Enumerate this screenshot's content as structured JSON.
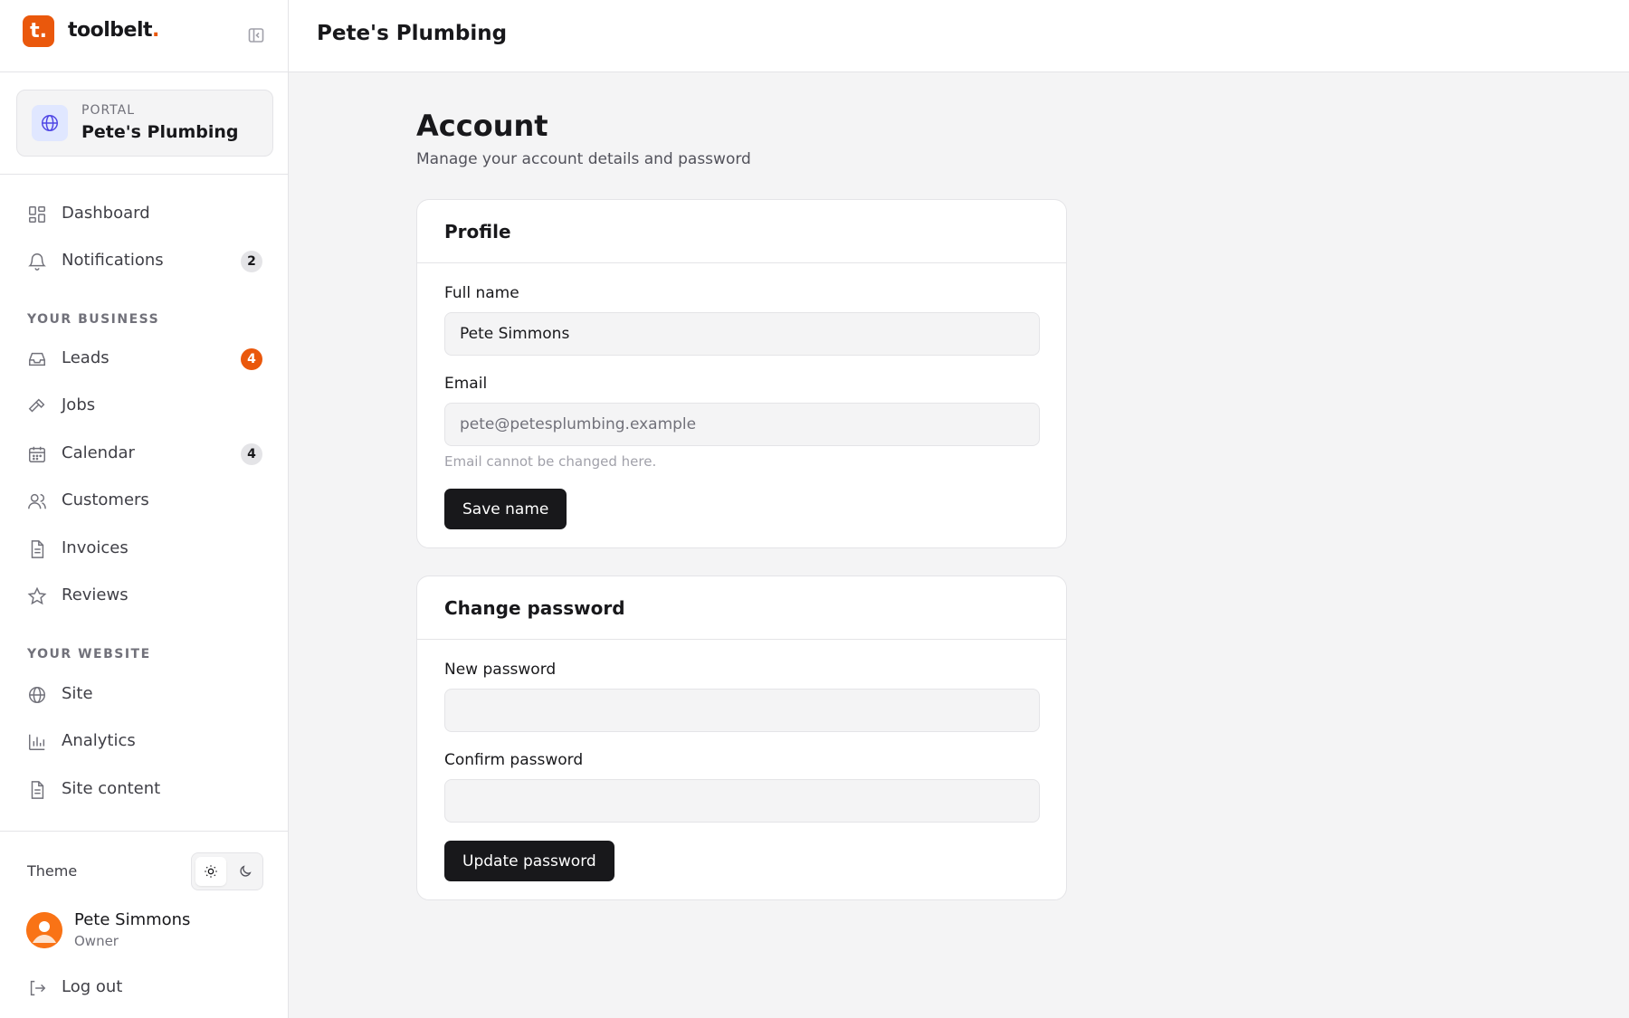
{
  "app": {
    "brand_name": "toolbelt",
    "brand_dot": ".",
    "logo_letter": "t.",
    "accent_color": "#ea580c"
  },
  "portal": {
    "kicker": "PORTAL",
    "name": "Pete's Plumbing"
  },
  "header": {
    "title": "Pete's Plumbing"
  },
  "nav": {
    "top": [
      {
        "label": "Dashboard",
        "icon": "grid-icon"
      },
      {
        "label": "Notifications",
        "icon": "bell-icon",
        "badge": "2"
      }
    ],
    "business_label": "YOUR BUSINESS",
    "business": [
      {
        "label": "Leads",
        "icon": "inbox-icon",
        "badge": "4"
      },
      {
        "label": "Jobs",
        "icon": "hammer-icon"
      },
      {
        "label": "Calendar",
        "icon": "calendar-icon",
        "badge": "4"
      },
      {
        "label": "Customers",
        "icon": "users-icon"
      },
      {
        "label": "Invoices",
        "icon": "file-icon"
      },
      {
        "label": "Reviews",
        "icon": "star-icon"
      }
    ],
    "website_label": "YOUR WEBSITE",
    "website": [
      {
        "label": "Site",
        "icon": "globe-icon"
      },
      {
        "label": "Analytics",
        "icon": "bar-chart-icon"
      },
      {
        "label": "Site content",
        "icon": "document-icon"
      }
    ]
  },
  "footer": {
    "theme_label": "Theme",
    "theme_selected": "light",
    "user_name": "Pete Simmons",
    "user_role": "Owner",
    "logout_label": "Log out"
  },
  "page": {
    "title": "Account",
    "subtitle": "Manage your account details and password"
  },
  "profile": {
    "title": "Profile",
    "full_name_label": "Full name",
    "full_name_value": "Pete Simmons",
    "email_label": "Email",
    "email_value": "pete@petesplumbing.example",
    "email_hint": "Email cannot be changed here.",
    "save_label": "Save name"
  },
  "password": {
    "title": "Change password",
    "new_label": "New password",
    "new_value": "",
    "confirm_label": "Confirm password",
    "confirm_value": "",
    "update_label": "Update password"
  }
}
